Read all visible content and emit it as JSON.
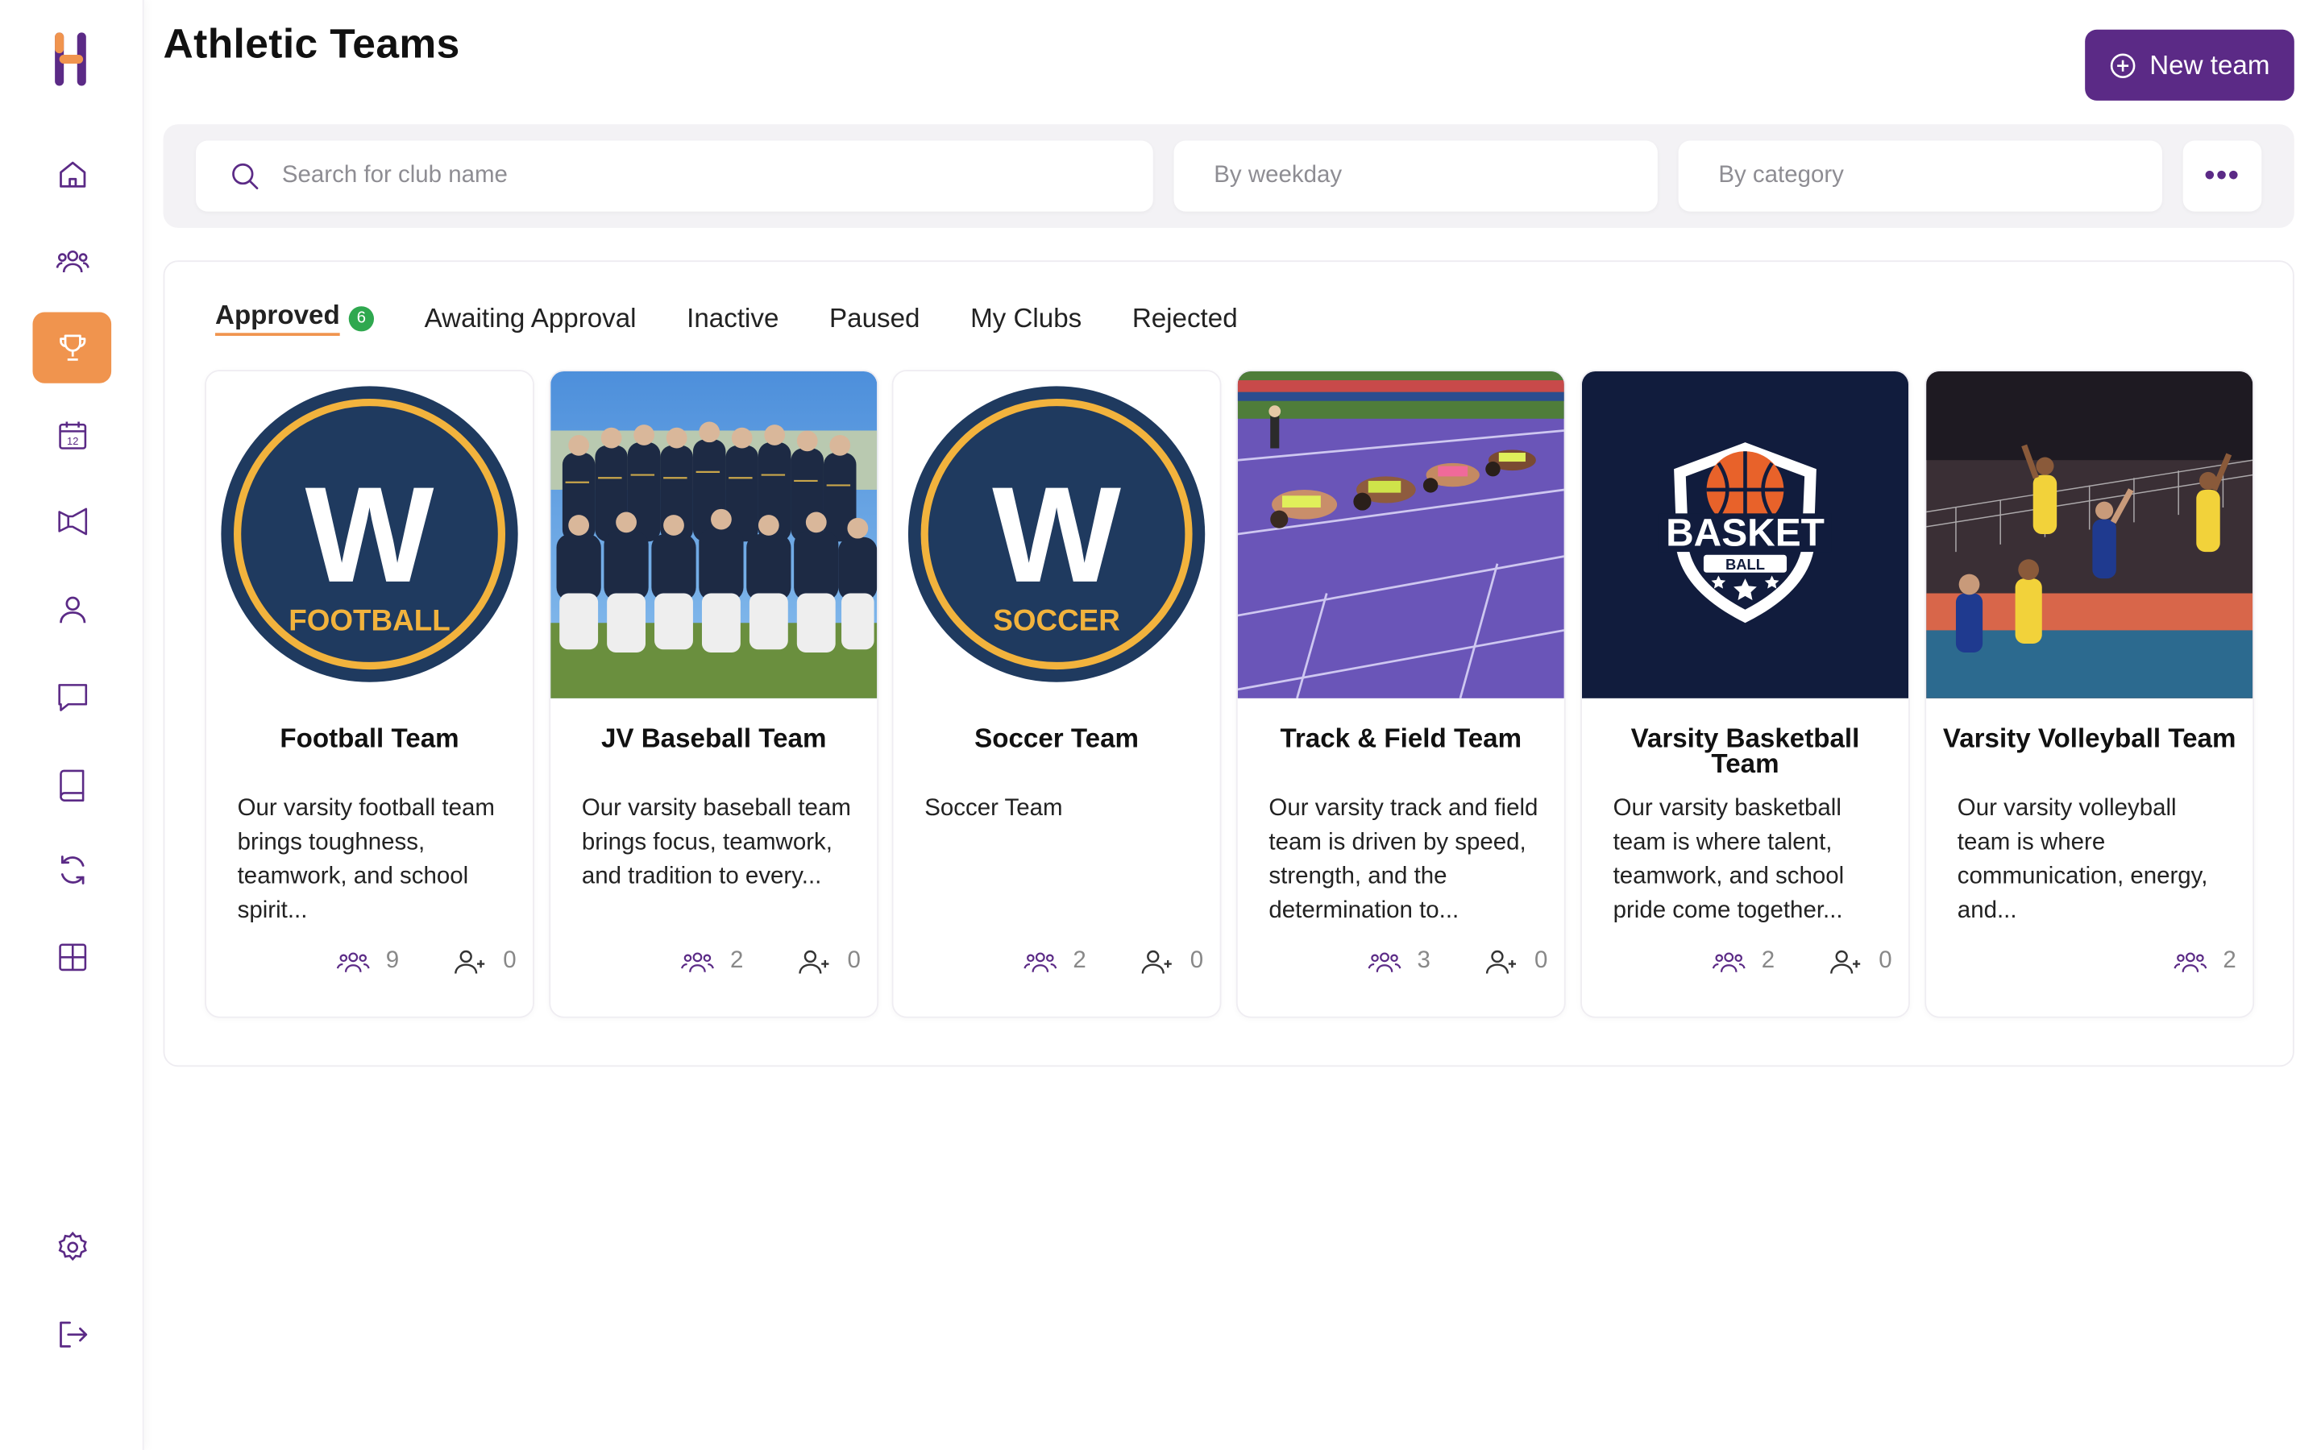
{
  "page": {
    "title": "Athletic Teams"
  },
  "header": {
    "new_team_label": "New team"
  },
  "filters": {
    "search_placeholder": "Search for club name",
    "weekday_placeholder": "By weekday",
    "category_placeholder": "By category",
    "more_label": "•••"
  },
  "sidebar": {
    "items": [
      {
        "icon": "home-icon",
        "active": false
      },
      {
        "icon": "users-icon",
        "active": false
      },
      {
        "icon": "trophy-icon",
        "active": true
      },
      {
        "icon": "calendar-icon",
        "label": "12",
        "active": false
      },
      {
        "icon": "megaphone-icon",
        "active": false
      },
      {
        "icon": "user-icon",
        "active": false
      },
      {
        "icon": "chat-icon",
        "active": false
      },
      {
        "icon": "book-icon",
        "active": false
      },
      {
        "icon": "refresh-icon",
        "active": false
      },
      {
        "icon": "grid-icon",
        "active": false
      },
      {
        "icon": "gear-icon",
        "active": false
      },
      {
        "icon": "logout-icon",
        "active": false
      }
    ]
  },
  "tabs": [
    {
      "label": "Approved",
      "badge": "6",
      "active": true
    },
    {
      "label": "Awaiting Approval"
    },
    {
      "label": "Inactive"
    },
    {
      "label": "Paused"
    },
    {
      "label": "My Clubs"
    },
    {
      "label": "Rejected"
    }
  ],
  "cards": [
    {
      "title": "Football Team",
      "image_text": "FOOTBALL",
      "image_letter": "W",
      "description": "Our varsity football team brings toughness, teamwork, and school spirit...",
      "members": "9",
      "requests": "0"
    },
    {
      "title": "JV Baseball Team",
      "description": "Our varsity baseball team brings focus, teamwork, and tradition to every...",
      "members": "2",
      "requests": "0"
    },
    {
      "title": "Soccer Team",
      "image_text": "SOCCER",
      "image_letter": "W",
      "description": "Soccer Team",
      "members": "2",
      "requests": "0"
    },
    {
      "title": "Track & Field Team",
      "description": "Our varsity track and field team is driven by speed, strength, and the determination to...",
      "members": "3",
      "requests": "0"
    },
    {
      "title": "Varsity Basketball Team",
      "image_text": "BASKET",
      "image_subtext": "BALL",
      "description": "Our varsity basketball team is where talent, teamwork, and school pride come together...",
      "members": "2",
      "requests": "0"
    },
    {
      "title": "Varsity Volleyball Team",
      "description": "Our varsity volleyball team is where communication, energy, and...",
      "members": "2"
    }
  ],
  "colors": {
    "brand_purple": "#5b2a86",
    "accent_orange": "#f0944e",
    "badge_green": "#2fa84f",
    "navy": "#1f3a5f",
    "gold": "#f2b33d"
  }
}
